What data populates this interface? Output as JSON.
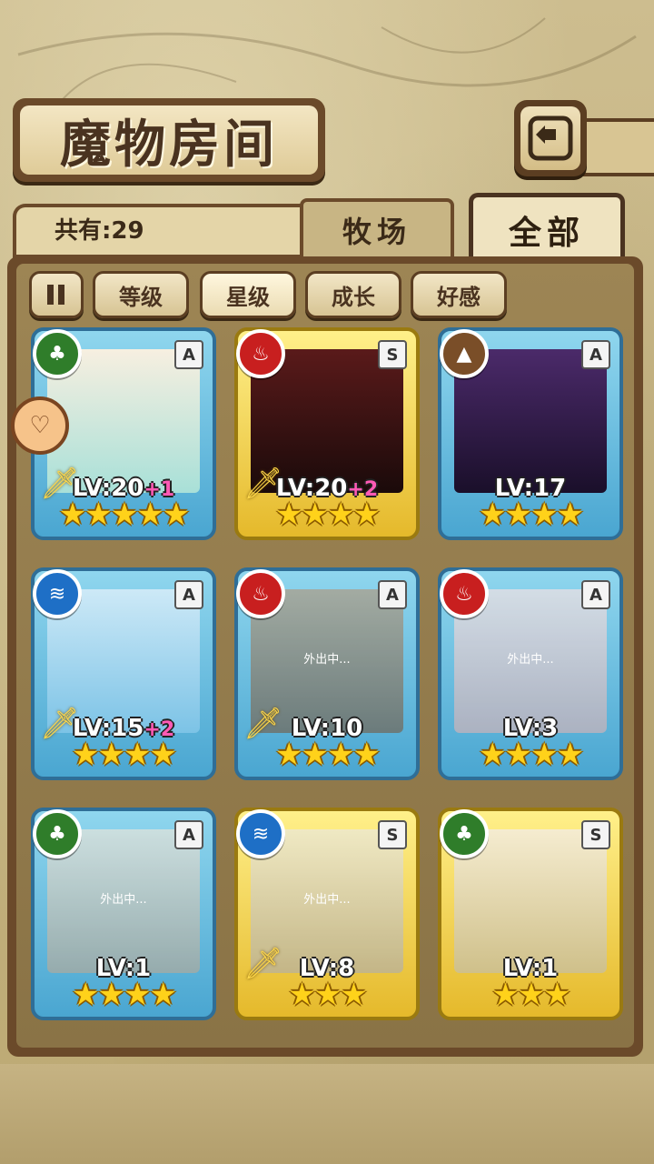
{
  "header": {
    "title": "魔物房间"
  },
  "info": {
    "count_label": "共有:29"
  },
  "tabs": {
    "ranch": "牧场",
    "all": "全部"
  },
  "filters": [
    "等级",
    "星级",
    "成长",
    "好感"
  ],
  "cards": [
    {
      "grade": "A",
      "element": "wood",
      "level": "LV:20",
      "plus": "+1",
      "stars": "★★★★★",
      "away": ""
    },
    {
      "grade": "S",
      "element": "fire",
      "level": "LV:20",
      "plus": "+2",
      "stars": "★★★★",
      "away": ""
    },
    {
      "grade": "A",
      "element": "earth",
      "level": "LV:17",
      "plus": "",
      "stars": "★★★★",
      "away": ""
    },
    {
      "grade": "A",
      "element": "water",
      "level": "LV:15",
      "plus": "+2",
      "stars": "★★★★",
      "away": ""
    },
    {
      "grade": "A",
      "element": "fire",
      "level": "LV:10",
      "plus": "",
      "stars": "★★★★",
      "away": "外出中..."
    },
    {
      "grade": "A",
      "element": "fire",
      "level": "LV:3",
      "plus": "",
      "stars": "★★★★",
      "away": "外出中..."
    },
    {
      "grade": "A",
      "element": "wood",
      "level": "LV:1",
      "plus": "",
      "stars": "★★★★",
      "away": "外出中..."
    },
    {
      "grade": "S",
      "element": "water",
      "level": "LV:8",
      "plus": "",
      "stars": "★★★",
      "away": "外出中..."
    },
    {
      "grade": "S",
      "element": "wood",
      "level": "LV:1",
      "plus": "",
      "stars": "★★★",
      "away": ""
    }
  ],
  "colors": {
    "panel": "#6b4a2a",
    "card_a": "#4aa6d1",
    "card_s": "#e5b92b",
    "plus": "#ff5ab5",
    "star": "#ffd21a"
  }
}
